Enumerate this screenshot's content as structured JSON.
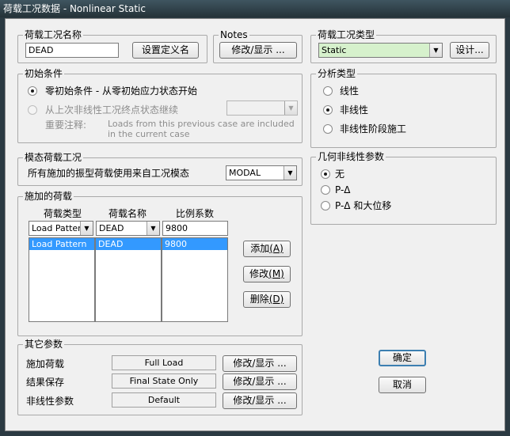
{
  "window": {
    "title": "荷载工况数据 - Nonlinear Static"
  },
  "case_name": {
    "legend": "荷载工况名称",
    "value": "DEAD",
    "define_button": "设置定义名"
  },
  "notes": {
    "legend": "Notes",
    "button": "修改/显示 ..."
  },
  "case_type": {
    "legend": "荷载工况类型",
    "value": "Static",
    "design_button": "设计..."
  },
  "initial_conditions": {
    "legend": "初始条件",
    "option_zero": "零初始条件 - 从零初始应力状态开始",
    "option_continue": "从上次非线性工况终点状态继续",
    "important_label": "重要注释:",
    "important_text": "Loads from this previous case are included in the current case"
  },
  "analysis_type": {
    "legend": "分析类型",
    "linear": "线性",
    "nonlinear": "非线性",
    "staged": "非线性阶段施工"
  },
  "modal_case": {
    "legend": "模态荷载工况",
    "label": "所有施加的振型荷载使用来自工况模态",
    "value": "MODAL"
  },
  "geometric_nonlinearity": {
    "legend": "几何非线性参数",
    "none": "无",
    "pdelta": "P-Δ",
    "pdelta_large": "P-Δ 和大位移"
  },
  "loads_applied": {
    "legend": "施加的荷载",
    "headers": [
      "荷载类型",
      "荷载名称",
      "比例系数"
    ],
    "input": {
      "type": "Load Pattern",
      "name": "DEAD",
      "factor": "9800"
    },
    "rows": [
      {
        "type": "Load Pattern",
        "name": "DEAD",
        "factor": "9800"
      }
    ],
    "add_button": "添加",
    "add_key": "(A)",
    "modify_button": "修改",
    "modify_key": "(M)",
    "delete_button": "删除",
    "delete_key": "(D)"
  },
  "other_params": {
    "legend": "其它参数",
    "load_application": {
      "label": "施加荷载",
      "value": "Full Load",
      "button": "修改/显示 ..."
    },
    "results_saved": {
      "label": "结果保存",
      "value": "Final State Only",
      "button": "修改/显示 ..."
    },
    "nonlinear_params": {
      "label": "非线性参数",
      "value": "Default",
      "button": "修改/显示 ..."
    }
  },
  "dialog": {
    "ok_button": "确定",
    "cancel_button": "取消"
  }
}
